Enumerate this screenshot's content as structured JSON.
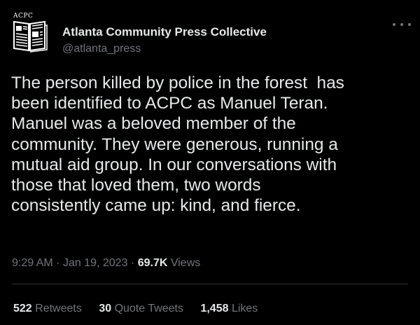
{
  "account": {
    "logo_text": "ACPC",
    "display_name": "Atlanta Community Press Collective",
    "handle": "@atlanta_press"
  },
  "tweet": {
    "lines": [
      "The person killed by police in the forest  has",
      "been identified to ACPC as Manuel Teran.",
      "Manuel was a beloved member of the",
      "community. They were generous, running a",
      "mutual aid group. In our conversations with",
      "those that loved them, two words",
      "consistently came up: kind, and fierce."
    ]
  },
  "meta": {
    "time": "9:29 AM",
    "separator": "·",
    "date": "Jan 19, 2023",
    "views_count": "69.7K",
    "views_label": "Views"
  },
  "stats": {
    "retweets_count": "522",
    "retweets_label": "Retweets",
    "quotes_count": "30",
    "quotes_label": "Quote Tweets",
    "likes_count": "1,458",
    "likes_label": "Likes"
  }
}
